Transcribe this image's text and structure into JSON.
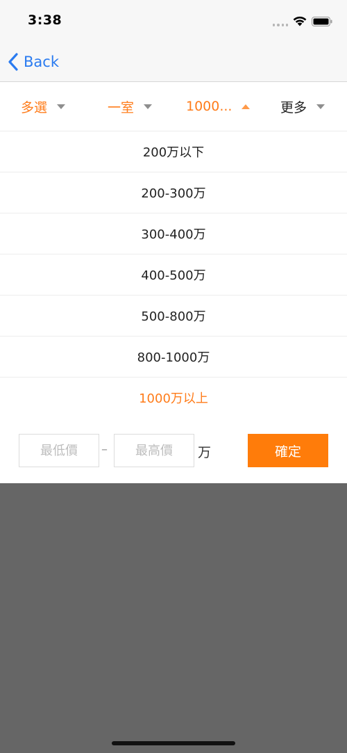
{
  "status_bar": {
    "time": "3:38",
    "icons": [
      "signal-icon",
      "wifi-icon",
      "battery-icon"
    ]
  },
  "nav": {
    "back_label": "Back",
    "back_icon": "chevron-left-icon"
  },
  "filters": [
    {
      "label": "多選",
      "state": "active",
      "arrow": "down"
    },
    {
      "label": "一室",
      "state": "active",
      "arrow": "down"
    },
    {
      "label": "1000...",
      "state": "open",
      "arrow": "up"
    },
    {
      "label": "更多",
      "state": "inactive",
      "arrow": "down"
    }
  ],
  "price_options": [
    {
      "label": "200万以下",
      "selected": false
    },
    {
      "label": "200-300万",
      "selected": false
    },
    {
      "label": "300-400万",
      "selected": false
    },
    {
      "label": "400-500万",
      "selected": false
    },
    {
      "label": "500-800万",
      "selected": false
    },
    {
      "label": "800-1000万",
      "selected": false
    },
    {
      "label": "1000万以上",
      "selected": true
    }
  ],
  "custom_range": {
    "min_placeholder": "最低價",
    "max_placeholder": "最高價",
    "dash": "–",
    "unit": "万",
    "confirm_label": "確定"
  },
  "colors": {
    "accent": "#ff7c1a",
    "link": "#2a7bf0",
    "overlay": "#666666"
  }
}
